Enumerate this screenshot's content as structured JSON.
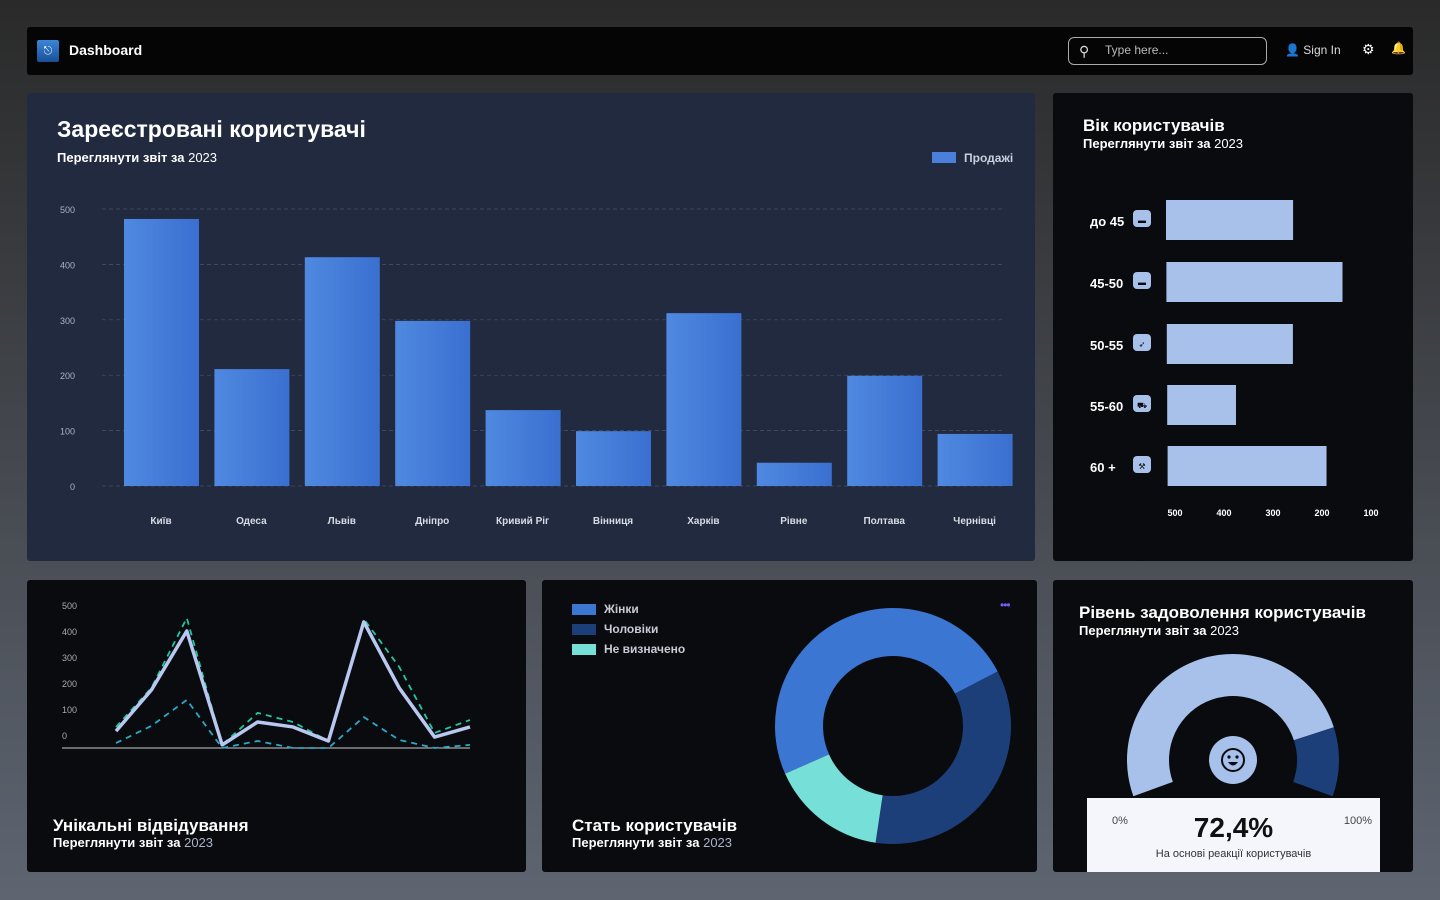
{
  "nav": {
    "title": "Dashboard",
    "search_placeholder": "Type here...",
    "signin": "Sign In"
  },
  "registered": {
    "title": "Зареєстровані користувачі",
    "subtitle_bold": "Переглянути звіт за",
    "subtitle_year": "2023",
    "legend": "Продажі",
    "chart_data": {
      "type": "bar",
      "categories": [
        "Київ",
        "Одеса",
        "Львів",
        "Дніпро",
        "Кривий Ріг",
        "Вінниця",
        "Харків",
        "Рівне",
        "Полтава",
        "Чернівці"
      ],
      "series": [
        {
          "name": "Продажі",
          "values": [
            482,
            211,
            413,
            298,
            137,
            99,
            312,
            42,
            199,
            94
          ]
        }
      ],
      "ylim": [
        0,
        500
      ],
      "yticks": [
        0,
        100,
        200,
        300,
        400,
        500
      ],
      "grid": true,
      "legend": "top-right",
      "color": "#4a80db"
    }
  },
  "age": {
    "title": "Вік користувачів",
    "subtitle_bold": "Переглянути звіт за",
    "subtitle_year": "2023",
    "chart_data": {
      "type": "bar",
      "orientation": "horizontal",
      "categories": [
        "до 45",
        "45-50",
        "50-55",
        "55-60",
        "60 +"
      ],
      "icons": [
        "wallet-icon",
        "card-icon",
        "rocket-icon",
        "cart-icon",
        "wrench-icon"
      ],
      "values": [
        259,
        159,
        261,
        378,
        194
      ],
      "xticks": [
        500,
        400,
        300,
        200,
        100
      ],
      "x_reversed": true,
      "color": "#a7c1ea"
    }
  },
  "visits": {
    "title": "Унікальні відвідування",
    "subtitle_bold": "Переглянути звіт за",
    "subtitle_year": "2023",
    "chart_data": {
      "type": "line",
      "yticks": [
        0,
        100,
        200,
        300,
        400,
        500
      ],
      "series": [
        {
          "style": "solid",
          "color": "#b8c8f0",
          "values": [
            15,
            173,
            400,
            -38,
            50,
            31,
            -23,
            435,
            181,
            -8,
            31
          ]
        },
        {
          "style": "dashed",
          "color": "#1fc8a0",
          "values": [
            31,
            181,
            450,
            -38,
            85,
            50,
            -23,
            446,
            262,
            8,
            58
          ]
        },
        {
          "style": "dashed",
          "color": "#2aa8c8",
          "values": [
            -31,
            35,
            135,
            -50,
            -23,
            -50,
            -50,
            69,
            -19,
            -50,
            -38
          ]
        }
      ]
    }
  },
  "gender": {
    "title": "Стать користувачів",
    "subtitle_bold": "Переглянути звіт за",
    "subtitle_year": "2023",
    "menu": "•••",
    "chart_data": {
      "type": "pie",
      "donut": true,
      "labels": [
        "Жінки",
        "Чоловіки",
        "Не визначено"
      ],
      "values": [
        49,
        35,
        16
      ],
      "colors": [
        "#3b76d3",
        "#1c3f79",
        "#76dfd8"
      ]
    }
  },
  "satisfaction": {
    "title": "Рівень задоволення користувачів",
    "subtitle_bold": "Переглянути звіт за",
    "subtitle_year": "2023",
    "value": 72.4,
    "value_label": "72,4%",
    "min": "0%",
    "max": "100%",
    "caption": "На основі реакції користувачів",
    "icon": "smile-icon"
  }
}
